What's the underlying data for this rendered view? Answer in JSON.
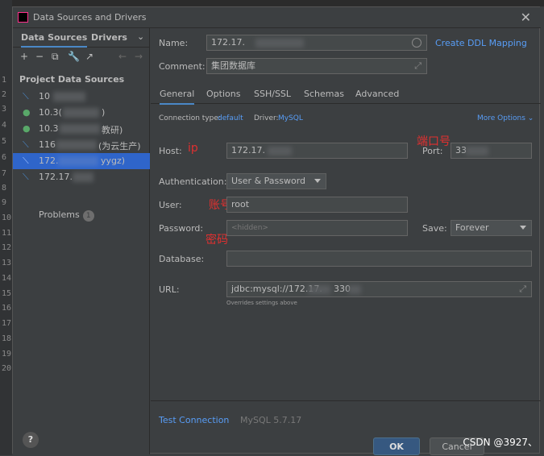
{
  "dialog": {
    "title": "Data Sources and Drivers",
    "close_icon": "close-icon"
  },
  "left": {
    "tabs": [
      "Data Sources",
      "Drivers"
    ],
    "section_title": "Project Data Sources",
    "datasources": [
      {
        "label": "10",
        "icon": "mysql-icon",
        "color": "#4a88c7"
      },
      {
        "label": "10.3(",
        "icon": "mongo-leaf-icon",
        "color": "#59a869",
        "suffix": ")"
      },
      {
        "label": "10.3",
        "icon": "mongo-leaf-icon",
        "color": "#59a869",
        "suffix": "教研)"
      },
      {
        "label": "116",
        "icon": "mysql-icon",
        "color": "#4a88c7",
        "suffix": "(为云生产)"
      },
      {
        "label": "172.",
        "icon": "mysql-icon",
        "color": "#4a88c7",
        "suffix": "yygz)"
      },
      {
        "label": "172.17.",
        "icon": "mysql-icon",
        "color": "#4a88c7"
      }
    ],
    "problems_label": "Problems",
    "problems_count": "1"
  },
  "form": {
    "name_label": "Name:",
    "name_value": "172.17.",
    "ddl_link": "Create DDL Mapping",
    "comment_label": "Comment:",
    "comment_value": "集团数据库",
    "tabs": [
      "General",
      "Options",
      "SSH/SSL",
      "Schemas",
      "Advanced"
    ],
    "conn_type_label": "Connection type:",
    "conn_type_value": "default",
    "driver_label": "Driver:",
    "driver_value": "MySQL",
    "more_options": "More Options",
    "host_label": "Host:",
    "host_value": "172.17.",
    "port_label": "Port:",
    "port_value": "33",
    "auth_label": "Authentication:",
    "auth_value": "User & Password",
    "user_label": "User:",
    "user_value": "root",
    "password_label": "Password:",
    "password_placeholder": "<hidden>",
    "save_label": "Save:",
    "save_value": "Forever",
    "database_label": "Database:",
    "database_value": "",
    "url_label": "URL:",
    "url_value": "jdbc:mysql://172.17.",
    "url_suffix": "330",
    "url_note": "Overrides settings above",
    "annot_ip": "ip",
    "annot_port": "端口号",
    "annot_user": "账号",
    "annot_password": "密码"
  },
  "footer": {
    "test_connection": "Test Connection",
    "mysql_version": "MySQL 5.7.17",
    "ok": "OK",
    "cancel": "Cancel",
    "watermark": "CSDN @3927、"
  },
  "gutter": [
    "1",
    "2",
    "3",
    "4",
    "5",
    "6",
    "7",
    "8",
    "9",
    "10",
    "11",
    "12",
    "13",
    "14",
    "15",
    "16",
    "17",
    "18",
    "19",
    "20"
  ]
}
